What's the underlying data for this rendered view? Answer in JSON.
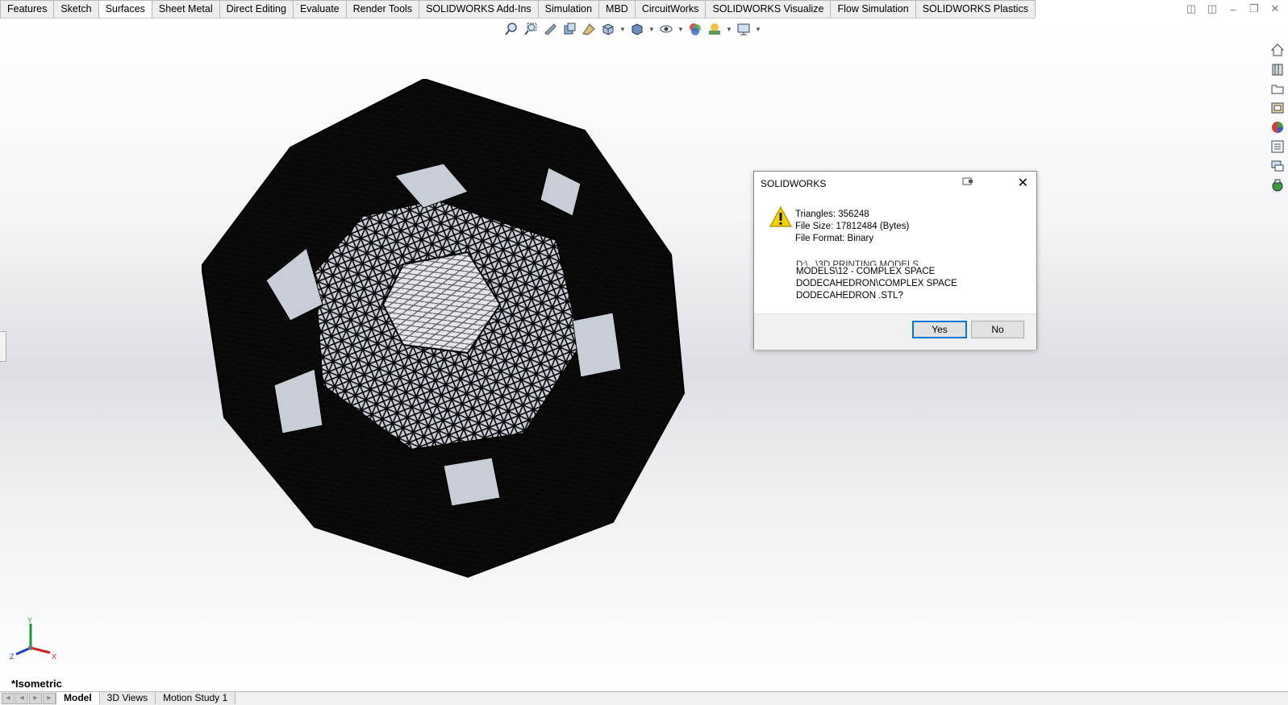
{
  "command_tabs": [
    "Features",
    "Sketch",
    "Surfaces",
    "Sheet Metal",
    "Direct Editing",
    "Evaluate",
    "Render Tools",
    "SOLIDWORKS Add-Ins",
    "Simulation",
    "MBD",
    "CircuitWorks",
    "SOLIDWORKS Visualize",
    "Flow Simulation",
    "SOLIDWORKS Plastics"
  ],
  "active_tab": "Surfaces",
  "dialog": {
    "title": "SOLIDWORKS",
    "line1": "Triangles: 356248",
    "line2": "File Size: 17812484 (Bytes)",
    "line3": "File Format: Binary",
    "path_clipped": "D:\\...\\3D PRINTING MODELS",
    "path1": "MODELS\\12 - COMPLEX SPACE",
    "path2": "DODECAHEDRON\\COMPLEX SPACE",
    "path3": "DODECAHEDRON .STL?",
    "yes_label": "Yes",
    "no_label": "No",
    "icon": "warning-icon"
  },
  "view": {
    "name": "*Isometric",
    "axis_x": "X",
    "axis_y": "Y",
    "axis_z": "Z"
  },
  "bottom_tabs": [
    "Model",
    "3D Views",
    "Motion Study 1"
  ],
  "active_bottom_tab": "Model",
  "colors": {
    "highlight": "#e8434b",
    "primary_button_border": "#0078d7",
    "axis_x": "#d02020",
    "axis_y": "#1a9a3a",
    "axis_z": "#2040c0"
  }
}
